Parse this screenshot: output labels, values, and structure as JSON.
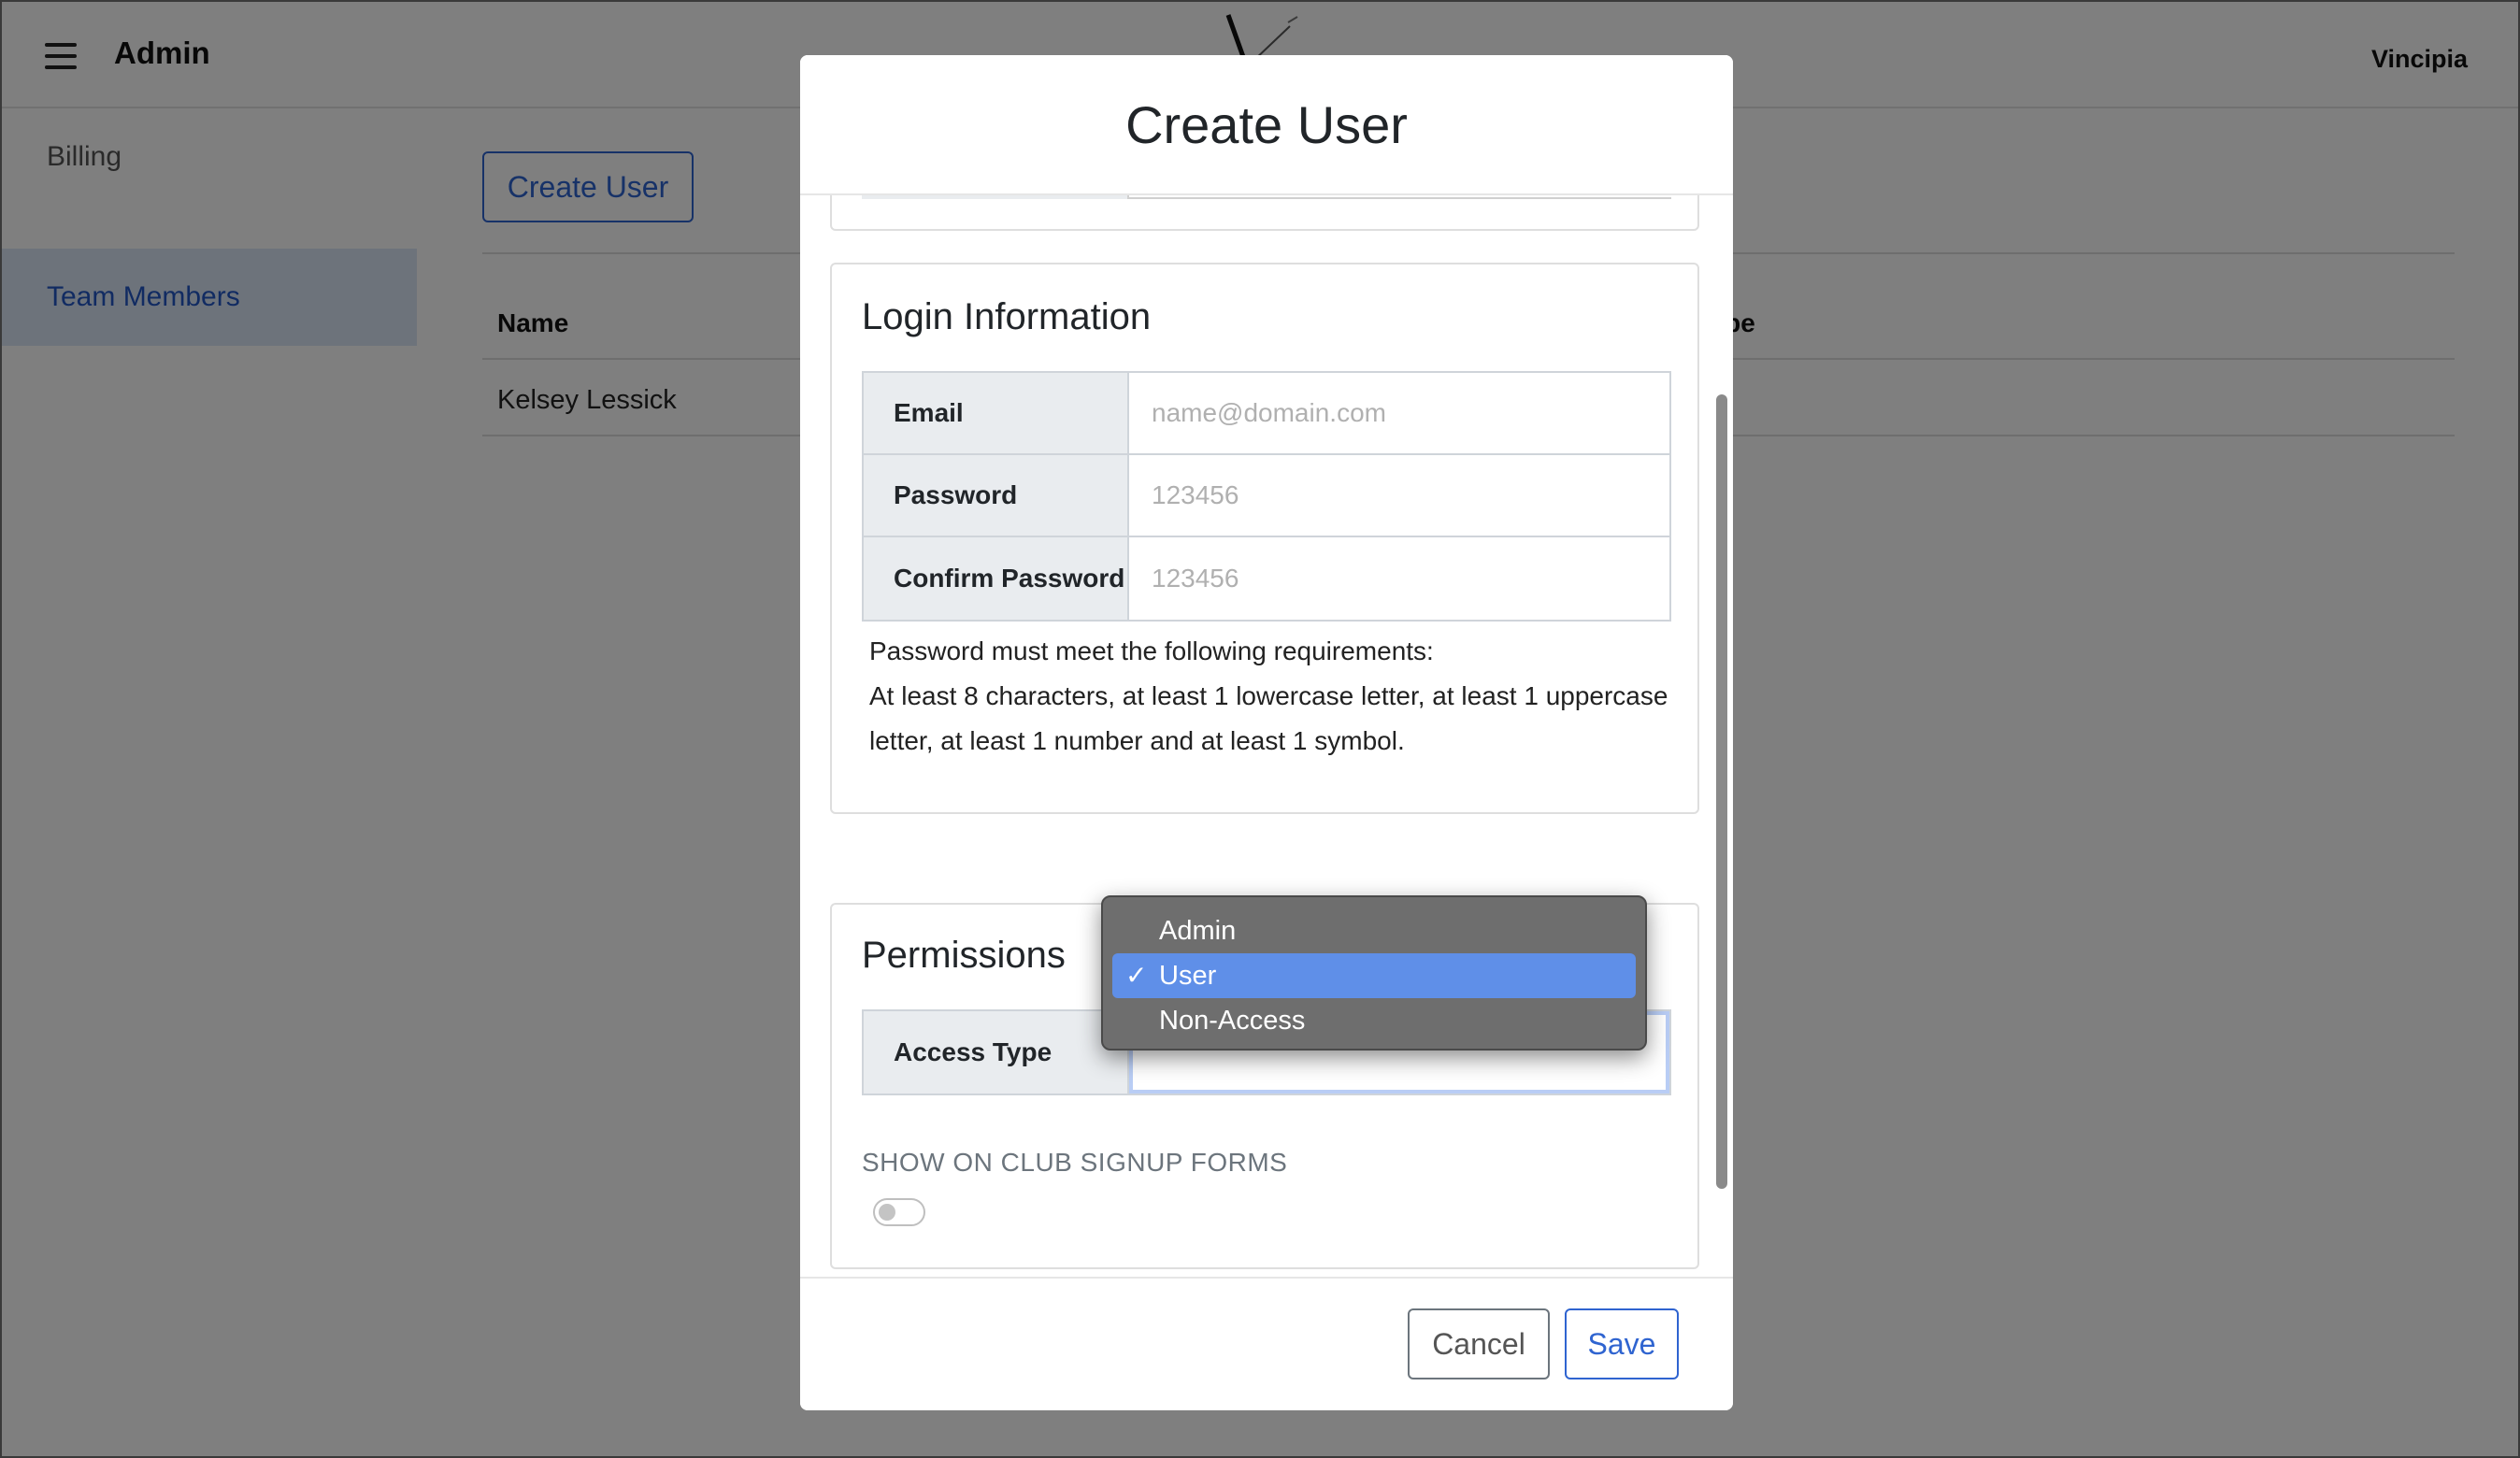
{
  "header": {
    "app_title": "Admin",
    "user_name": "Vincipia",
    "menu_icon": "hamburger-menu-icon",
    "logo_icon": "brand-logo-icon"
  },
  "sidebar": {
    "items": [
      {
        "label": "Billing"
      },
      {
        "label": "Team Members",
        "active": true
      }
    ]
  },
  "main": {
    "create_button": "Create User",
    "table": {
      "columns": [
        "Name",
        "ess Type"
      ],
      "rows": [
        [
          "Kelsey Lessick"
        ]
      ]
    }
  },
  "modal": {
    "title": "Create User",
    "login": {
      "heading": "Login Information",
      "email_label": "Email",
      "email_placeholder": "name@domain.com",
      "password_label": "Password",
      "password_placeholder": "123456",
      "confirm_label": "Confirm Password",
      "confirm_placeholder": "123456",
      "req_line1": "Password must meet the following requirements:",
      "req_line2": "At least 8 characters, at least 1 lowercase letter, at least 1 uppercase letter, at least 1 number and at least 1 symbol."
    },
    "permissions": {
      "heading": "Permissions",
      "access_label": "Access Type",
      "access_selected": "User",
      "access_options": [
        "Admin",
        "User",
        "Non-Access"
      ],
      "signup_label": "SHOW ON CLUB SIGNUP FORMS",
      "signup_toggle_on": false
    },
    "cancel_button": "Cancel",
    "save_button": "Save"
  },
  "colors": {
    "accent": "#2f64d0",
    "active_sidebar_bg": "#dbe6f7",
    "dropdown_bg": "#6e6e6e",
    "dropdown_selected": "#5f8fe8"
  }
}
